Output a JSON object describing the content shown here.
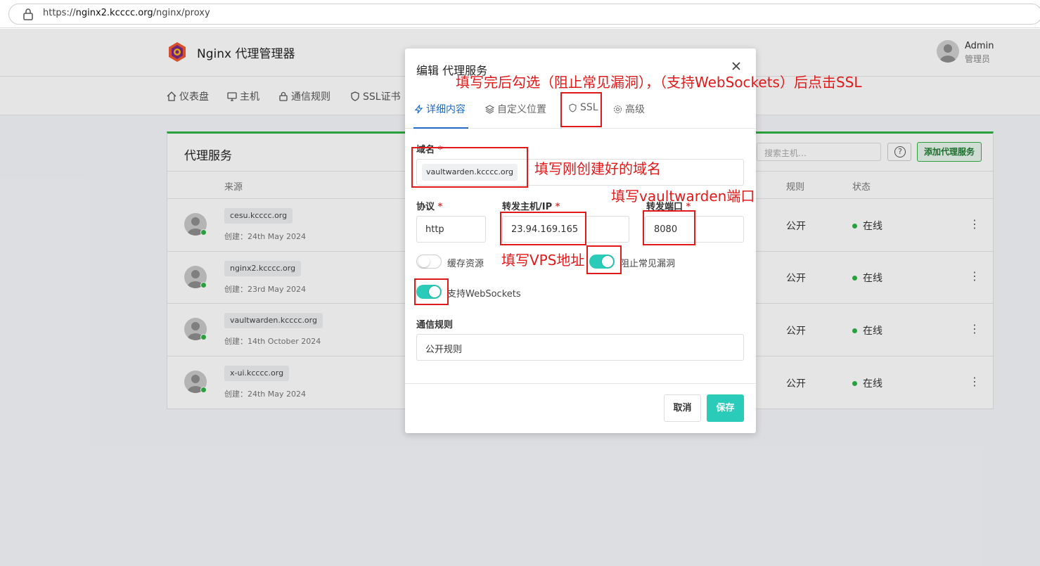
{
  "browser": {
    "url_prefix": "https://",
    "url_host": "nginx2.kcccc.org",
    "url_path": "/nginx/proxy"
  },
  "app": {
    "title": "Nginx 代理管理器",
    "user": {
      "name": "Admin",
      "role": "管理员"
    },
    "nav": [
      {
        "label": "仪表盘",
        "icon": "home-icon"
      },
      {
        "label": "主机",
        "icon": "monitor-icon"
      },
      {
        "label": "通信规则",
        "icon": "lock-icon"
      },
      {
        "label": "SSL证书",
        "icon": "shield-icon"
      }
    ],
    "card": {
      "title": "代理服务",
      "search_placeholder": "搜索主机…",
      "help_label": "?",
      "add_label": "添加代理服务",
      "columns": {
        "source": "来源",
        "rule": "规则",
        "status": "状态"
      }
    },
    "rows": [
      {
        "domain": "cesu.kcccc.org",
        "created": "创建：24th May 2024",
        "rule": "公开",
        "status": "在线",
        "menu": "⋮"
      },
      {
        "domain": "nginx2.kcccc.org",
        "created": "创建：23rd May 2024",
        "rule": "公开",
        "status": "在线",
        "menu": "⋮"
      },
      {
        "domain": "vaultwarden.kcccc.org",
        "created": "创建：14th October 2024",
        "rule": "公开",
        "status": "在线",
        "menu": "⋮"
      },
      {
        "domain": "x-ui.kcccc.org",
        "created": "创建：24th May 2024",
        "rule": "公开",
        "status": "在线",
        "menu": "⋮"
      }
    ]
  },
  "modal": {
    "title": "编辑 代理服务",
    "tabs": [
      {
        "label": "详细内容",
        "icon": "bolt-icon",
        "active": true
      },
      {
        "label": "自定义位置",
        "icon": "layers-icon",
        "active": false
      },
      {
        "label": "SSL",
        "icon": "shield-icon",
        "active": false
      },
      {
        "label": "高级",
        "icon": "gear-icon",
        "active": false
      }
    ],
    "domain_label": "域名",
    "domain_value": "vaultwarden.kcccc.org",
    "scheme_label": "协议",
    "scheme_value": "http",
    "host_label": "转发主机/IP",
    "host_value": "23.94.169.165",
    "port_label": "转发端口",
    "port_value": "8080",
    "required_mark": "*",
    "toggles": {
      "cache": {
        "label": "缓存资源",
        "on": false
      },
      "block_exploits": {
        "label": "阻止常见漏洞",
        "on": true
      },
      "websockets": {
        "label": "支持WebSockets",
        "on": true
      }
    },
    "access_label": "通信规则",
    "access_value": "公开规则",
    "cancel_label": "取消",
    "save_label": "保存"
  },
  "annotations": {
    "top_note": "填写完后勾选（阻止常见漏洞），（支持WebSockets）后点击SSL",
    "domain_note": "填写刚创建好的域名",
    "port_note": "填写vaultwarden端口",
    "vps_note": "填写VPS地址"
  },
  "colors": {
    "accent_teal": "#2bcbba",
    "accent_blue": "#206bc4",
    "green": "#2fb344",
    "annotation_red": "#e0191b"
  }
}
